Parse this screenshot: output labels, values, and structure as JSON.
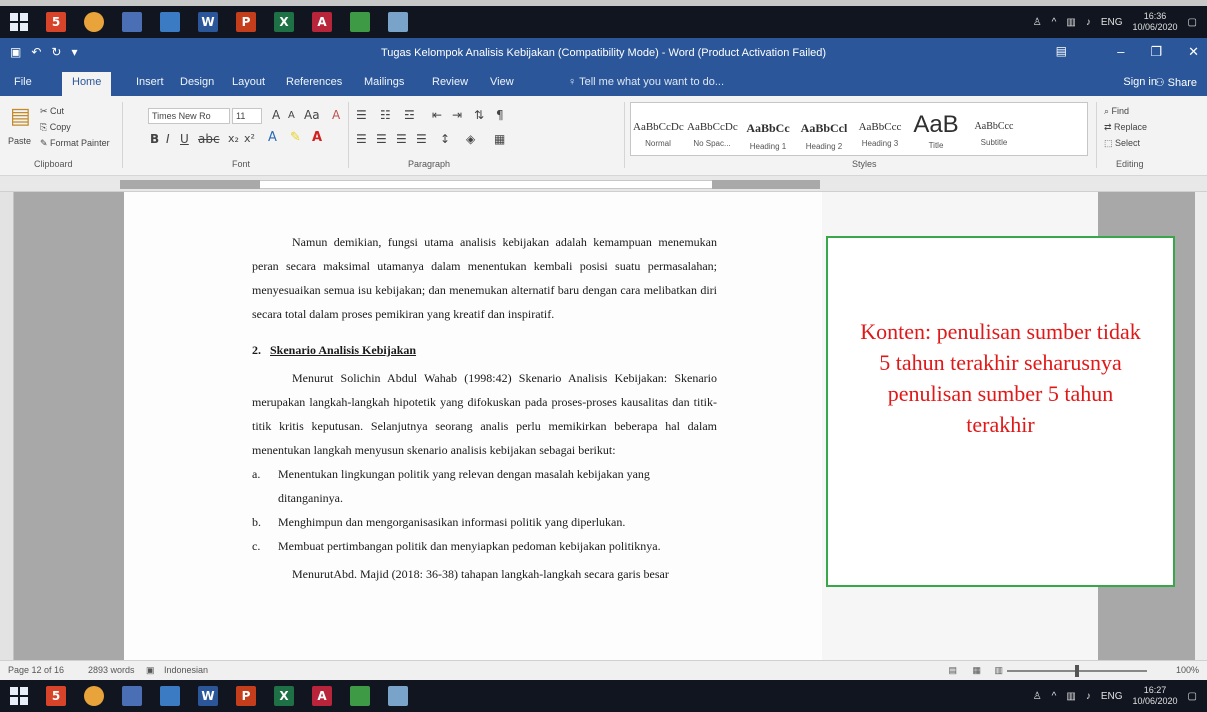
{
  "window": {
    "title": "Tugas Kelompok Analisis Kebijakan (Compatibility Mode) - Word (Product Activation Failed)",
    "quick_access": [
      "save",
      "undo",
      "redo"
    ],
    "controls": [
      "minimize",
      "restore",
      "close"
    ]
  },
  "tabs": [
    {
      "label": "File"
    },
    {
      "label": "Home"
    },
    {
      "label": "Insert"
    },
    {
      "label": "Design"
    },
    {
      "label": "Layout"
    },
    {
      "label": "References"
    },
    {
      "label": "Mailings"
    },
    {
      "label": "Review"
    },
    {
      "label": "View"
    }
  ],
  "tell_me": "Tell me what you want to do...",
  "sign_in": "Sign in",
  "share": "Share",
  "ribbon": {
    "clipboard": {
      "paste": "Paste",
      "cut": "Cut",
      "copy": "Copy",
      "format_painter": "Format Painter",
      "label": "Clipboard"
    },
    "font": {
      "name": "Times New Ro",
      "size": "11",
      "label": "Font"
    },
    "paragraph": {
      "label": "Paragraph"
    },
    "styles": {
      "label": "Styles",
      "items": [
        {
          "sample": "AaBbCcDc",
          "name": "Normal"
        },
        {
          "sample": "AaBbCcDc",
          "name": "No Spac..."
        },
        {
          "sample": "AaBbCc",
          "name": "Heading 1"
        },
        {
          "sample": "AaBbCcl",
          "name": "Heading 2"
        },
        {
          "sample": "AaBbCcc",
          "name": "Heading 3"
        },
        {
          "sample": "AaB",
          "name": "Title"
        },
        {
          "sample": "AaBbCcc",
          "name": "Subtitle"
        }
      ]
    },
    "editing": {
      "find": "Find",
      "replace": "Replace",
      "select": "Select",
      "label": "Editing"
    }
  },
  "document": {
    "para1": "Namun demikian, fungsi utama analisis kebijakan adalah kemampuan menemukan peran secara maksimal utamanya dalam menentukan kembali posisi suatu permasalahan; menyesuaikan semua isu kebijakan; dan menemukan alternatif baru dengan cara melibatkan diri secara total dalam proses pemikiran yang kreatif dan inspiratif.",
    "heading_num": "2.",
    "heading": "Skenario Analisis Kebijakan",
    "para2": "Menurut Solichin Abdul Wahab (1998:42) Skenario Analisis Kebijakan: Skenario merupakan langkah-langkah hipotetik yang difokuskan pada proses-proses kausalitas dan titik-titik kritis keputusan. Selanjutnya seorang analis perlu memikirkan beberapa hal dalam menentukan langkah menyusun skenario analisis kebijakan sebagai berikut:",
    "list": [
      {
        "marker": "a.",
        "text": "Menentukan lingkungan politik yang relevan dengan masalah kebijakan yang ditanganinya."
      },
      {
        "marker": "b.",
        "text": "Menghimpun dan mengorganisasikan informasi politik yang diperlukan."
      },
      {
        "marker": "c.",
        "text": "Membuat pertimbangan politik dan menyiapkan pedoman kebijakan politiknya."
      }
    ],
    "para3": "MenurutAbd. Majid (2018: 36-38) tahapan langkah-langkah secara garis besar"
  },
  "annotation": {
    "text": "Konten: penulisan sumber tidak 5 tahun terakhir seharusnya penulisan sumber 5 tahun terakhir",
    "border_color": "#3aa64a",
    "text_color": "#e01818"
  },
  "status": {
    "page": "Page 12 of 16",
    "words": "2893 words",
    "language": "Indonesian",
    "zoom": "100%"
  },
  "taskbar": {
    "top_clock_time": "16:36",
    "top_clock_date": "10/06/2020",
    "bottom_clock_time": "16:27",
    "bottom_clock_date": "10/06/2020",
    "lang": "ENG"
  },
  "colors": {
    "word_blue": "#2b579a"
  }
}
